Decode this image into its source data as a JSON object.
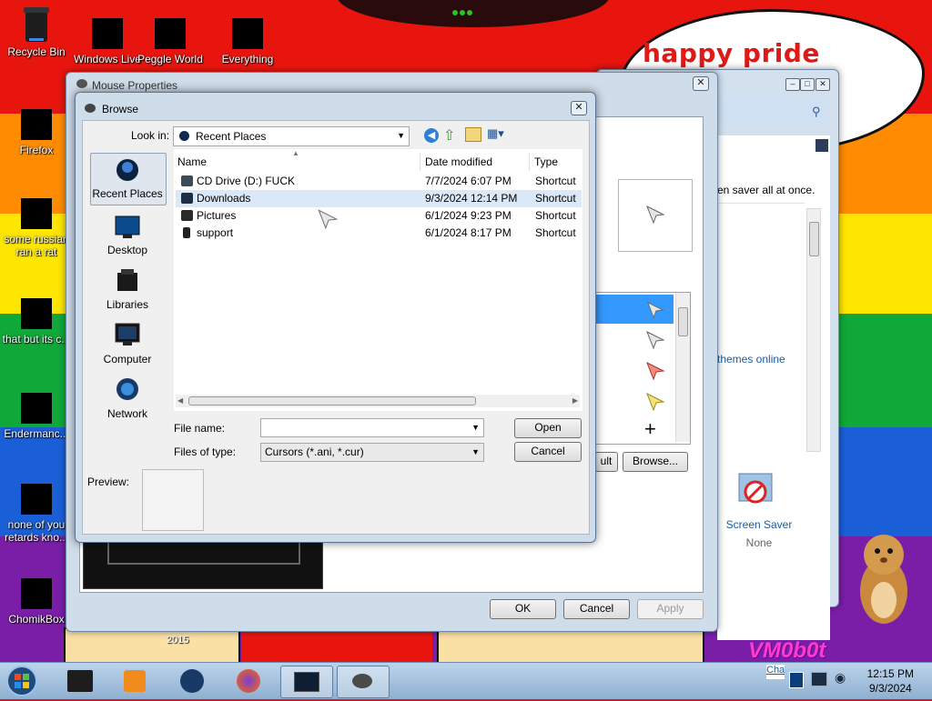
{
  "desktop": {
    "icons": [
      {
        "label": "Recycle Bin"
      },
      {
        "label": "Windows Live"
      },
      {
        "label": "Peggle World"
      },
      {
        "label": "Everything"
      },
      {
        "label": "Firefox"
      },
      {
        "label": "some russian ran a rat"
      },
      {
        "label": "that but its c..."
      },
      {
        "label": "Endermanc..."
      },
      {
        "label": "none of you retards kno..."
      },
      {
        "label": "ChomikBox"
      }
    ],
    "speech_text": "happy pride month",
    "watermark_year": "2015",
    "watermark_text": "VM0b0t"
  },
  "mouse_properties": {
    "title": "Mouse Properties",
    "ok": "OK",
    "cancel": "Cancel",
    "apply": "Apply",
    "use_default": "ult",
    "browse": "Browse..."
  },
  "personalization": {
    "text_saver": "en saver all at once.",
    "themes_link": "themes online",
    "screen_saver_label": "Screen Saver",
    "screen_saver_value": "None"
  },
  "browse_dialog": {
    "title": "Browse",
    "look_in_label": "Look in:",
    "look_in_value": "Recent Places",
    "places": [
      {
        "label": "Recent Places",
        "icon": "recent-places-icon"
      },
      {
        "label": "Desktop",
        "icon": "desktop-icon"
      },
      {
        "label": "Libraries",
        "icon": "libraries-icon"
      },
      {
        "label": "Computer",
        "icon": "computer-icon"
      },
      {
        "label": "Network",
        "icon": "network-icon"
      }
    ],
    "columns": [
      "Name",
      "Date modified",
      "Type"
    ],
    "files": [
      {
        "name": "CD Drive (D:) FUCK",
        "date": "7/7/2024 6:07 PM",
        "type": "Shortcut"
      },
      {
        "name": "Downloads",
        "date": "9/3/2024 12:14 PM",
        "type": "Shortcut"
      },
      {
        "name": "Pictures",
        "date": "6/1/2024 9:23 PM",
        "type": "Shortcut"
      },
      {
        "name": "support",
        "date": "6/1/2024 8:17 PM",
        "type": "Shortcut"
      }
    ],
    "file_name_label": "File name:",
    "file_name_value": "",
    "files_of_type_label": "Files of type:",
    "files_of_type_value": "Cursors (*.ani, *.cur)",
    "open": "Open",
    "cancel": "Cancel",
    "preview_label": "Preview:"
  },
  "taskbar": {
    "time": "12:15 PM",
    "date": "9/3/2024",
    "tray_text": "Cha"
  }
}
